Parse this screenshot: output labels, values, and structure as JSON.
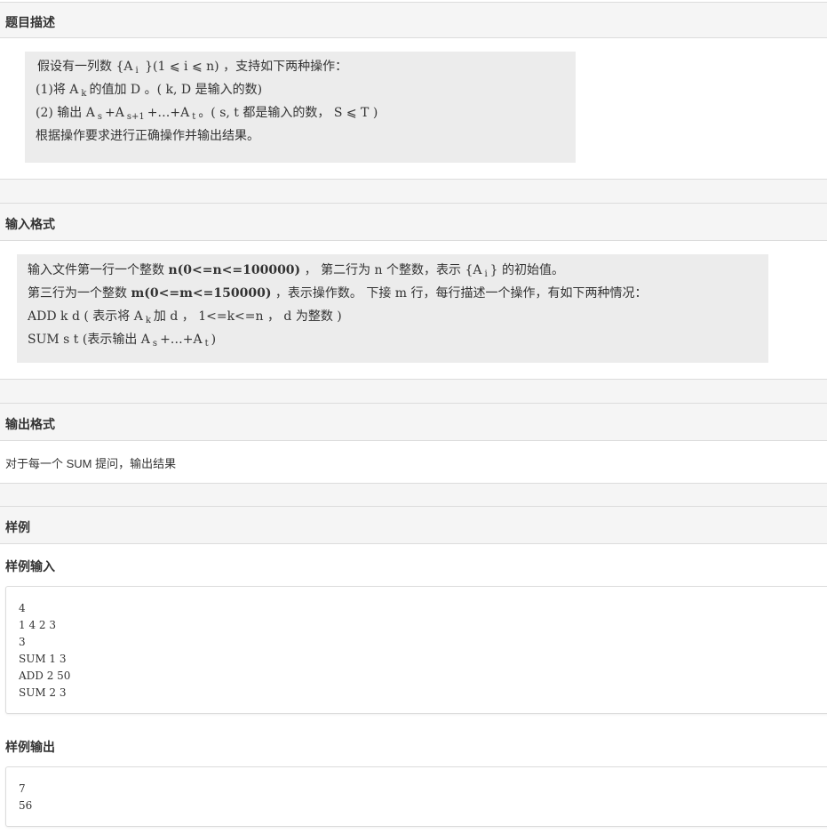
{
  "sections": {
    "description_title": "题目描述",
    "input_format_title": "输入格式",
    "output_format_title": "输出格式",
    "sample_title": "样例",
    "sample_input_title": "样例输入",
    "sample_output_title": "样例输出"
  },
  "description": {
    "line1_a": "  假设有一列数 {A",
    "line1_sub": "i",
    "line1_b": " }(1 ⩽ i ⩽ n) ，支持如下两种操作：",
    "line2_a": "(1)将 A",
    "line2_sub": "k",
    "line2_b": "的值加 D 。( k, D 是输入的数)",
    "line3_a": "(2) 输出 A",
    "line3_sub1": "s",
    "line3_b": "+A",
    "line3_sub2": "s+1",
    "line3_c": "+…+A",
    "line3_sub3": "t",
    "line3_d": "。( s, t 都是输入的数， S ⩽ T )",
    "line4": "根据操作要求进行正确操作并输出结果。"
  },
  "input_format": {
    "line1_a": "输入文件第一行一个整数 ",
    "line1_bold": "n(0<=n<=100000)",
    "line1_b": " ， 第二行为 n 个整数，表示 {A",
    "line1_sub": "i",
    "line1_c": "} 的初始值。",
    "line2_a": "第三行为一个整数 ",
    "line2_bold": "m(0<=m<=150000)",
    "line2_b": " ，表示操作数。 下接 m 行，每行描述一个操作，有如下两种情况：",
    "line3_a": "ADD k d ( 表示将 A",
    "line3_sub": "k",
    "line3_b": "加 d ， 1<=k<=n ， d 为整数 )",
    "line4_a": "SUM s t (表示输出 A",
    "line4_sub1": "s",
    "line4_b": "+…+A",
    "line4_sub2": "t",
    "line4_c": ")"
  },
  "output_format": {
    "text": "对于每一个 SUM 提问，输出结果"
  },
  "sample_input": {
    "lines": [
      "4",
      "1 4 2 3",
      "3",
      "SUM 1 3",
      "ADD 2 50",
      "SUM 2 3"
    ]
  },
  "sample_output": {
    "lines": [
      "7",
      "56"
    ]
  }
}
